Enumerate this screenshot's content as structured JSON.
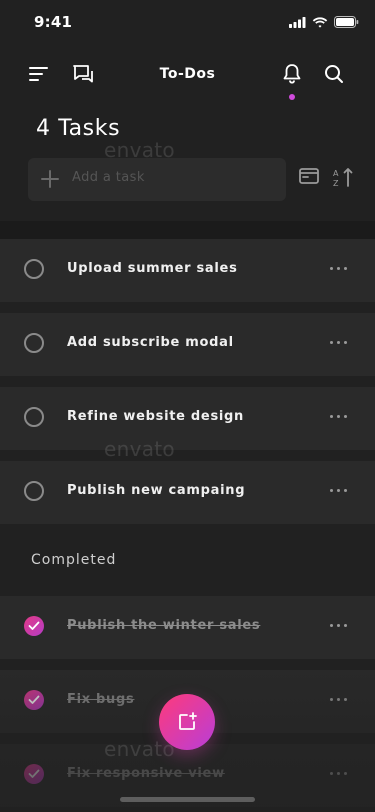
{
  "status": {
    "time": "9:41"
  },
  "header": {
    "title": "To-Dos",
    "icons": [
      "menu-icon",
      "chat-icon",
      "bell-icon",
      "search-icon"
    ],
    "notification_color": "#d04bdc"
  },
  "tasks_heading": "4 Tasks",
  "add_task": {
    "placeholder": "Add a task"
  },
  "tasks": [
    {
      "label": "Upload summer sales"
    },
    {
      "label": "Add subscribe modal"
    },
    {
      "label": "Refine website design"
    },
    {
      "label": "Publish new campaing"
    }
  ],
  "completed_heading": "Completed",
  "completed": [
    {
      "label": "Publish the winter sales"
    },
    {
      "label": "Fix bugs"
    },
    {
      "label": "Fix responsive view"
    }
  ],
  "watermark": "envato",
  "colors": {
    "accent_start": "#ff3a7a",
    "accent_end": "#b83ed8",
    "background": "#212121",
    "row": "#2a2a2a"
  }
}
